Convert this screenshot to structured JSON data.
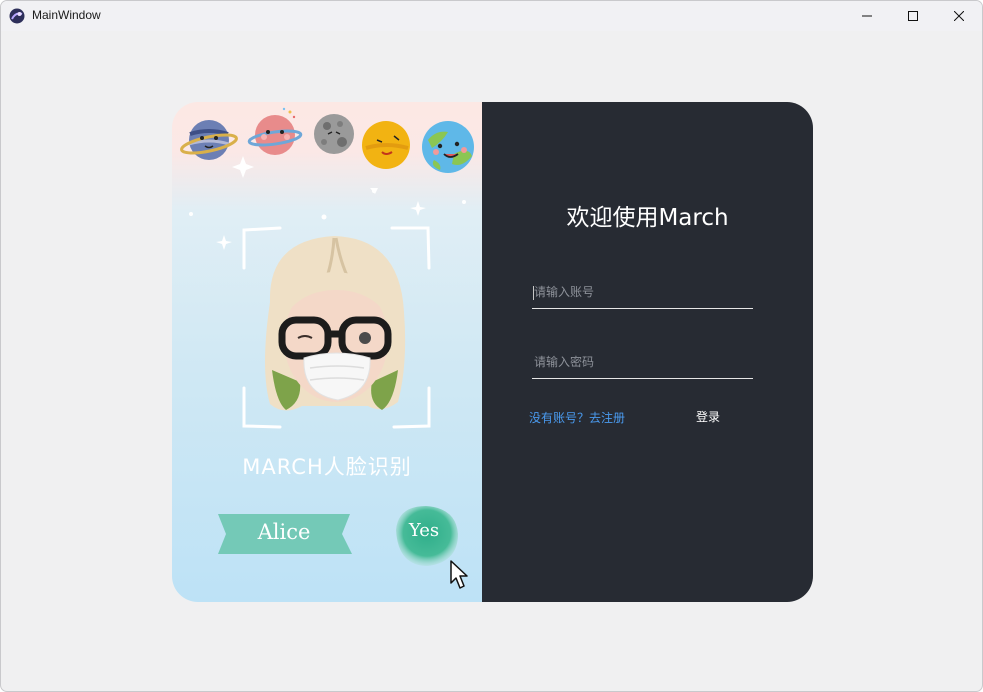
{
  "window": {
    "title": "MainWindow",
    "controls": {
      "minimize": "minimize-icon",
      "maximize": "maximize-icon",
      "close": "close-icon"
    }
  },
  "left": {
    "caption": "MARCH人脸识别",
    "name_badge": "Alice",
    "confirm_badge": "Yes"
  },
  "login": {
    "welcome": "欢迎使用March",
    "account_placeholder": "请输入账号",
    "password_placeholder": "请输入密码",
    "register_link": "没有账号？去注册",
    "login_button": "登录"
  },
  "colors": {
    "panel_dark": "#272b33",
    "link_blue": "#4a9bf0",
    "badge_teal": "#5cc2a8",
    "window_bg": "#f0f0f1"
  }
}
